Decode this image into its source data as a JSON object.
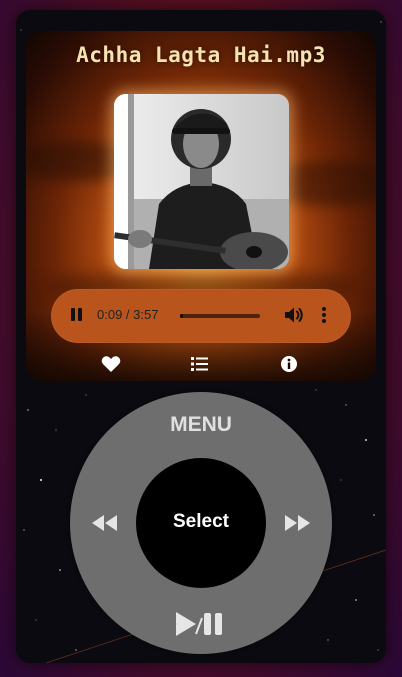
{
  "player": {
    "song_title": "Achha Lagta Hai.mp3",
    "current_time": "0:09",
    "duration": "3:57",
    "time_display": "0:09 / 3:57",
    "progress_fraction": 0.04,
    "is_playing": true
  },
  "actions": {
    "icons": [
      "heart-icon",
      "playlist-icon",
      "info-icon"
    ]
  },
  "wheel": {
    "menu_label": "MENU",
    "select_label": "Select",
    "icons": [
      "rewind-icon",
      "fast-forward-icon",
      "play-pause-icon"
    ]
  },
  "colors": {
    "title": "#f6e3b0",
    "audio_bar": "#b8541c",
    "wheel": "#6e6e6e",
    "select_button": "#000000"
  }
}
